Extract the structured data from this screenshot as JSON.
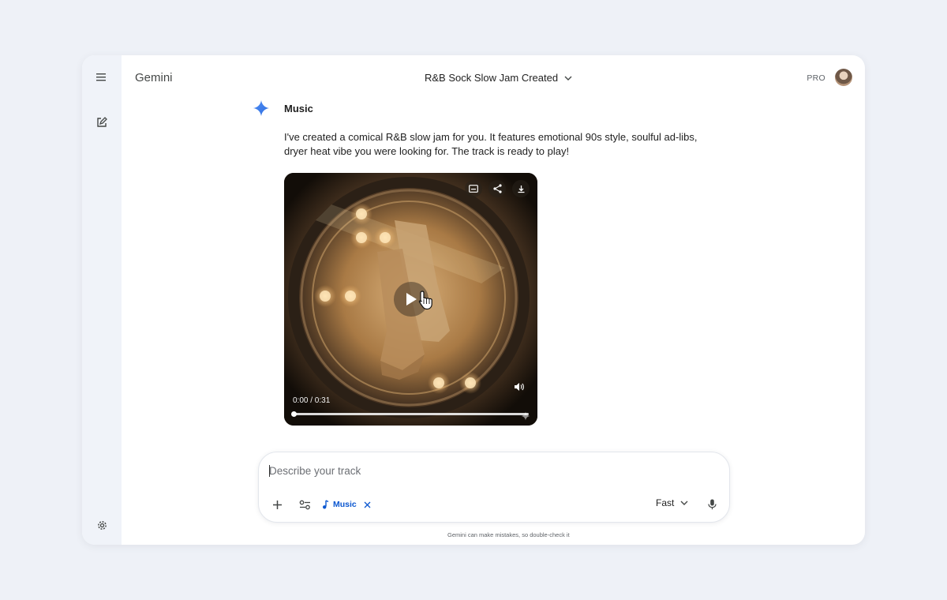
{
  "app": {
    "name": "Gemini",
    "plan_badge": "PRO"
  },
  "conversation": {
    "title": "R&B Sock Slow Jam Created"
  },
  "sidebar": {
    "icons": [
      "menu-icon",
      "new-chat-icon",
      "settings-icon"
    ]
  },
  "response": {
    "tool_label": "Music",
    "text": "I've created a comical R&B slow jam for you. It features emotional 90s style, soulful ad-libs, dryer heat vibe you were looking for. The track is ready to play!",
    "player": {
      "time": "0:00 / 0:31",
      "progress": 0.0,
      "controls": [
        "captions-icon",
        "share-icon",
        "download-icon"
      ]
    }
  },
  "composer": {
    "placeholder": "Describe your track",
    "value": "",
    "tool_chip": "Music",
    "mode": "Fast"
  },
  "footer": {
    "disclaimer": "Gemini can make mistakes, so double-check it"
  },
  "colors": {
    "accent": "#0b57d0",
    "background": "#eef1f7",
    "rail": "#f0f3f9"
  }
}
